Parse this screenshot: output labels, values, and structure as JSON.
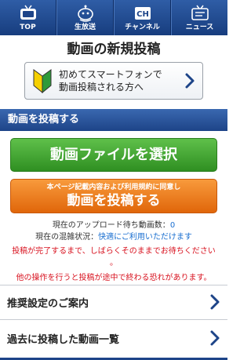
{
  "nav": {
    "items": [
      {
        "label": "TOP",
        "icon": "tv-icon"
      },
      {
        "label": "生放送",
        "icon": "robot-icon"
      },
      {
        "label": "チャンネル",
        "icon": "channel-icon"
      },
      {
        "label": "ニュース",
        "icon": "news-tv-icon"
      }
    ]
  },
  "page": {
    "title": "動画の新規投稿"
  },
  "beginner": {
    "line1": "初めてスマートフォンで",
    "line2": "動画投稿される方へ"
  },
  "section": {
    "title": "動画を投稿する"
  },
  "buttons": {
    "select_file": "動画ファイルを選択",
    "post_note": "本ページ記載内容および利用規約に同意し",
    "post_main": "動画を投稿する"
  },
  "status": {
    "queue_label": "現在のアップロード待ち動画数：",
    "queue_count": "0",
    "congestion_label": "現在の混雑状況：",
    "congestion_value": "快適にご利用いただけます"
  },
  "warning": {
    "line1": "投稿が完了するまで、しばらくそのままでお待ちください",
    "line1_tail": "。",
    "line2": "他の操作を行うと投稿が途中で終わる恐れがあります。"
  },
  "links": [
    {
      "label": "推奨設定のご案内"
    },
    {
      "label": "過去に投稿した動画一覧"
    }
  ],
  "colors": {
    "nav": "#1d4488",
    "select_button": "#3fa52f",
    "post_button": "#f07f20",
    "warning": "#d8121f",
    "link_blue": "#1a6fd0"
  }
}
